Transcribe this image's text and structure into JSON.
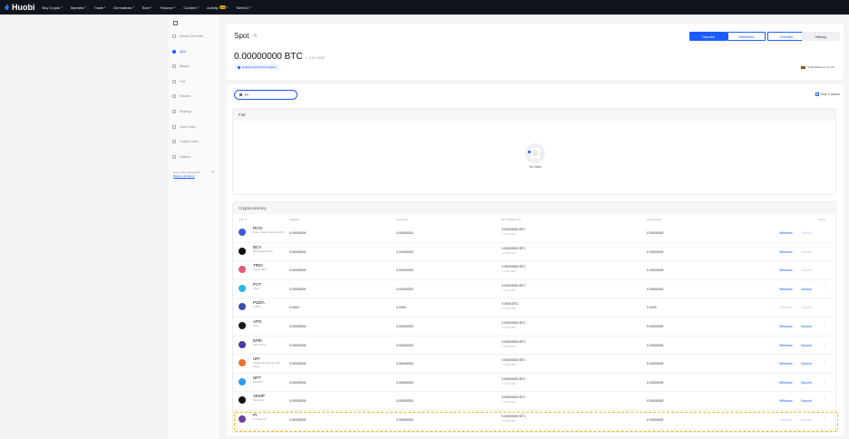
{
  "nav": {
    "logo": "Huobi",
    "items": [
      {
        "label": "Buy Crypto",
        "caret": "▾"
      },
      {
        "label": "Markets",
        "caret": "▾"
      },
      {
        "label": "Trade",
        "caret": "▾"
      },
      {
        "label": "Derivatives",
        "caret": "▾"
      },
      {
        "label": "Earn",
        "caret": "▾"
      },
      {
        "label": "Finance",
        "caret": "▾"
      },
      {
        "label": "Content",
        "caret": "▾"
      },
      {
        "label": "Activity",
        "badge": "new",
        "caret": "▾"
      },
      {
        "label": "Web3.0",
        "caret": "▾"
      }
    ]
  },
  "sidebar": {
    "items": [
      {
        "label": "Assets Overview"
      },
      {
        "label": "Spot"
      },
      {
        "label": "Margin"
      },
      {
        "label": "Fiat"
      },
      {
        "label": "Futures"
      },
      {
        "label": "Strategy"
      },
      {
        "label": "Huobi Earn"
      },
      {
        "label": "Crypto Loans"
      },
      {
        "label": "Options"
      }
    ],
    "note": "How is the old layout?",
    "note_link": "Back to old layout",
    "note_close": "✕"
  },
  "header": {
    "title": "Spot",
    "eye_label": "👁",
    "balance": "0.00000000 BTC",
    "balance_fiat": "≈ 0.00 VND",
    "profit_link": "Enable Asset Profit Analysis",
    "buttons": {
      "deposit": "Deposit",
      "withdraw": "Withdraw",
      "transfer": "Transfer",
      "history": "History"
    },
    "small_balances": "Small Balances for HT"
  },
  "search": {
    "value": "Pi"
  },
  "hide_zero": "Hide 0 assets",
  "fiat_section": {
    "title": "Fiat",
    "nodata": "No Data"
  },
  "crypto_section": {
    "title": "Cryptocurrency",
    "columns": {
      "coin": "Coin ⇅",
      "available": "Available",
      "on_orders": "On Orders",
      "btc_valuation": "BTC Valuation ⇅",
      "lock_position": "Lock Position",
      "action": "Action"
    },
    "rows": [
      {
        "symbol": "RCN",
        "name": "Ripio Credit Network RCN",
        "available": "0.00000000",
        "on_orders": "0.00000000",
        "btc": "0.00000000 BTC",
        "fiat": "≈ 0.00 VND",
        "lock": "0.00000000",
        "withdraw": "Withdraw",
        "deposit": "Deposit",
        "color": "#3a5bd9",
        "dep_enabled": false,
        "more": ""
      },
      {
        "symbol": "BCV",
        "name": "BitCapitalVendor",
        "available": "0.00000000",
        "on_orders": "0.00000000",
        "btc": "0.00000000 BTC",
        "fiat": "≈ 0.00 VND",
        "lock": "0.00000000",
        "withdraw": "Withdraw",
        "deposit": "Deposit",
        "color": "#111111",
        "dep_enabled": false,
        "more": ""
      },
      {
        "symbol": "TRIO",
        "name": "Tripio TRIO",
        "available": "0.00000000",
        "on_orders": "0.00000000",
        "btc": "0.00000000 BTC",
        "fiat": "≈ 0.00 VND",
        "lock": "0.00000000",
        "withdraw": "Withdraw",
        "deposit": "Deposit",
        "color": "#e5587a",
        "dep_enabled": false,
        "more": ""
      },
      {
        "symbol": "PVT",
        "name": "Pivot",
        "available": "0.00000000",
        "on_orders": "0.00000000",
        "btc": "0.00000000 BTC",
        "fiat": "≈ 0.00 VND",
        "lock": "0.00000000",
        "withdraw": "Withdraw",
        "deposit": "Deposit",
        "color": "#28b6e8",
        "dep_enabled": true,
        "more": "⋮"
      },
      {
        "symbol": "PIZZA",
        "name": "PIZZA",
        "available": "0.0000",
        "on_orders": "0.0000",
        "btc": "0.0000 BTC",
        "fiat": "≈ 0.00 VND",
        "lock": "0.0000",
        "withdraw": "Withdraw",
        "deposit": "Deposit",
        "color": "#3a4fb0",
        "dep_enabled": false,
        "more": "",
        "wd_enabled": false
      },
      {
        "symbol": "APG",
        "name": "APG",
        "available": "0.00000000",
        "on_orders": "0.00000000",
        "btc": "0.00000000 BTC",
        "fiat": "≈ 0.00 VND",
        "lock": "0.00000000",
        "withdraw": "Withdraw",
        "deposit": "Deposit",
        "color": "#1a1a1a",
        "dep_enabled": true,
        "more": "⋮"
      },
      {
        "symbol": "EPIK",
        "name": "Epik Prime",
        "available": "0.00000000",
        "on_orders": "0.00000000",
        "btc": "0.00000000 BTC",
        "fiat": "≈ 0.00 VND",
        "lock": "0.00000000",
        "withdraw": "Withdraw",
        "deposit": "Deposit",
        "color": "#4b3aa8",
        "dep_enabled": true,
        "more": "⋮"
      },
      {
        "symbol": "UPI",
        "name": "Pawtocol Network UPI Token",
        "available": "0.00000000",
        "on_orders": "0.00000000",
        "btc": "0.00000000 BTC",
        "fiat": "≈ 0.00 VND",
        "lock": "0.00000000",
        "withdraw": "Withdraw",
        "deposit": "Deposit",
        "color": "#f07030",
        "dep_enabled": true,
        "more": "⋮"
      },
      {
        "symbol": "NPT",
        "name": "NEOPin",
        "available": "0.00000000",
        "on_orders": "0.00000000",
        "btc": "0.00000000 BTC",
        "fiat": "≈ 0.00 VND",
        "lock": "0.00000000",
        "withdraw": "Withdraw",
        "deposit": "Deposit",
        "color": "#2a9df4",
        "dep_enabled": true,
        "more": "⋮"
      },
      {
        "symbol": "VEMP",
        "name": "VEmpire",
        "available": "0.00000000",
        "on_orders": "0.00000000",
        "btc": "0.00000000 BTC",
        "fiat": "≈ 0.00 VND",
        "lock": "0.00000000",
        "withdraw": "Withdraw",
        "deposit": "Deposit",
        "color": "#111111",
        "dep_enabled": true,
        "more": "⋮"
      },
      {
        "symbol": "PI",
        "name": "Pi Network",
        "available": "0.00000000",
        "on_orders": "0.00000000",
        "btc": "0.00000000 BTC",
        "fiat": "≈ 0.00 VND",
        "lock": "0.00000000",
        "withdraw": "Withdraw",
        "deposit": "Deposit",
        "color": "#6b3fa0",
        "dep_enabled": false,
        "more": "⋮",
        "wd_enabled": false
      }
    ]
  },
  "colors": {
    "accent": "#1a5cff",
    "nav_bg": "#10141c",
    "highlight": "#f0b90b"
  }
}
